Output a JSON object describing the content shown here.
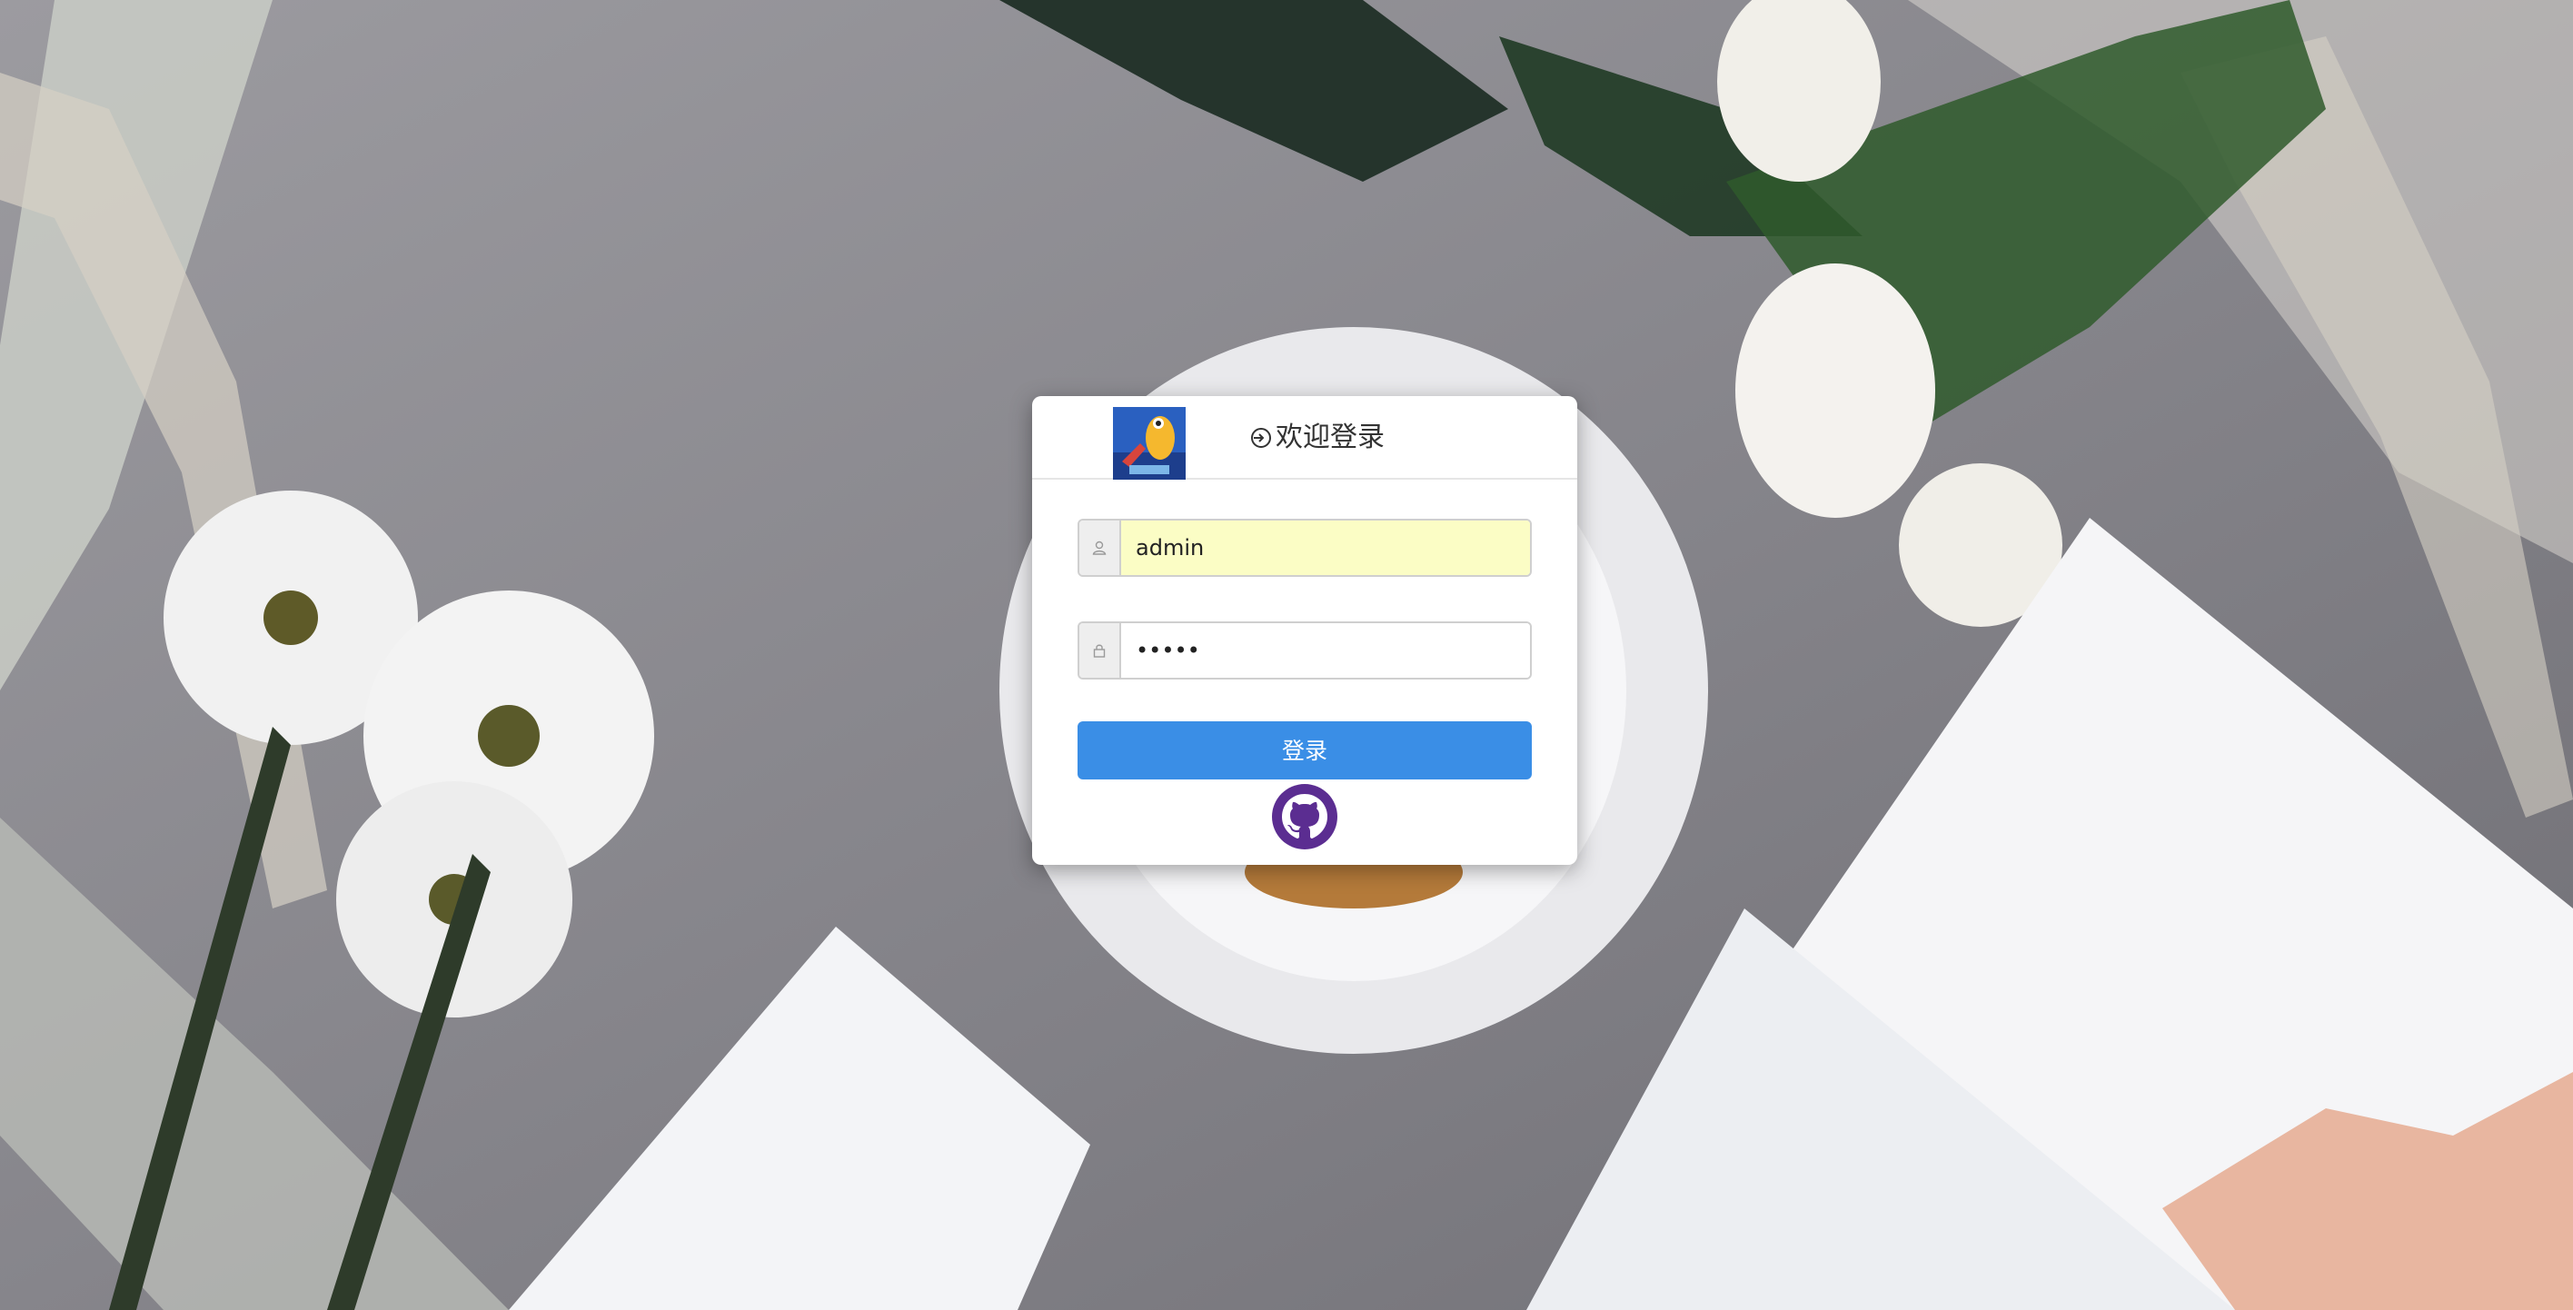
{
  "login": {
    "title": "欢迎登录",
    "username": {
      "value": "admin",
      "icon": "user-icon"
    },
    "password": {
      "value": "•••••",
      "icon": "lock-icon"
    },
    "submit_label": "登录",
    "github_icon": "github-icon"
  },
  "colors": {
    "primary": "#3a8ee6",
    "autofill": "#fbfdc5",
    "github": "#5b2d91"
  }
}
